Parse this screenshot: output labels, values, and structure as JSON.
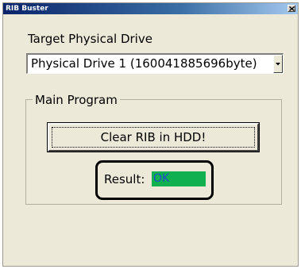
{
  "window": {
    "title": "RIB Buster",
    "close_glyph": "×"
  },
  "drive": {
    "label": "Target Physical Drive",
    "selected": "Physical Drive 1 (160041885696byte)"
  },
  "main_program": {
    "group_title": "Main Program",
    "clear_button_label": "Clear RIB in HDD!",
    "result_label": "Result:",
    "result_value": "OK"
  },
  "colors": {
    "title_bar": "#0a246a",
    "window_bg": "#ece9d8",
    "result_bg": "#10b050",
    "result_text": "#1e4ec8"
  },
  "icons": {
    "close": "close-icon",
    "dropdown": "chevron-down-icon"
  }
}
